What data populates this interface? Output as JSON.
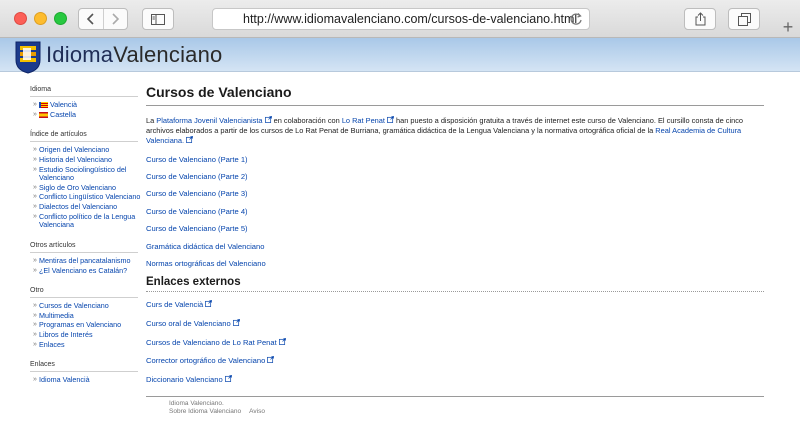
{
  "browser": {
    "url": "http://www.idiomavalenciano.com/cursos-de-valenciano.html",
    "new_tab_label": "+"
  },
  "site": {
    "logo_part1": "Idioma",
    "logo_part2": "Valenciano"
  },
  "sidebar": {
    "sections": [
      {
        "heading": "Idioma",
        "items": [
          "Valencià",
          "Castella"
        ]
      },
      {
        "heading": "Índice de artículos",
        "items": [
          "Origen del Valenciano",
          "Historia del Valenciano",
          "Estudio Sociolingüístico del Valenciano",
          "Siglo de Oro Valenciano",
          "Conflicto Lingüístico Valenciano",
          "Dialectos del Valenciano",
          "Conflicto político de la Lengua Valenciana"
        ]
      },
      {
        "heading": "Otros artículos",
        "items": [
          "Mentiras del pancatalanismo",
          "¿El Valenciano es Catalán?"
        ]
      },
      {
        "heading": "Otro",
        "items": [
          "Cursos de Valenciano",
          "Multimedia",
          "Programas en Valenciano",
          "Libros de Interés",
          "Enlaces"
        ]
      },
      {
        "heading": "Enlaces",
        "items": [
          "Idioma Valencià"
        ]
      }
    ]
  },
  "main": {
    "title": "Cursos de Valenciano",
    "intro": {
      "t1": "La ",
      "link1": "Plataforma Jovenil Valencianista",
      "t2": " en colaboración con ",
      "link2": "Lo Rat Penat",
      "t3": " han puesto a disposición gratuita a través de internet este curso de Valenciano. El cursillo consta de cinco archivos elaborados a partir de los cursos de Lo Rat Penat de Burriana, gramática didáctica de la Lengua Valenciana y la normativa ortográfica oficial de la ",
      "link3": "Real Academia de Cultura Valenciana.",
      "t4": ""
    },
    "course_links": [
      "Curso de Valenciano (Parte 1)",
      "Curso de Valenciano (Parte 2)",
      "Curso de Valenciano (Parte 3)",
      "Curso de Valenciano (Parte 4)",
      "Curso de Valenciano (Parte 5)",
      "Gramática didáctica del Valenciano",
      "Normas ortográficas del Valenciano"
    ],
    "external_title": "Enlaces externos",
    "external_links": [
      "Curs de Valencià",
      "Curso oral de Valenciano",
      "Cursos de Valenciano de Lo Rat Penat",
      "Corrector ortográfico de Valenciano",
      "Diccionario Valenciano"
    ]
  },
  "footer": {
    "line1": "Idioma Valenciano.",
    "about": "Sobre Idioma Valenciano",
    "notice": "Aviso"
  },
  "colors": {
    "link": "#0645ad",
    "header_top": "#a9c8e8",
    "header_bottom": "#d4e4f4"
  }
}
